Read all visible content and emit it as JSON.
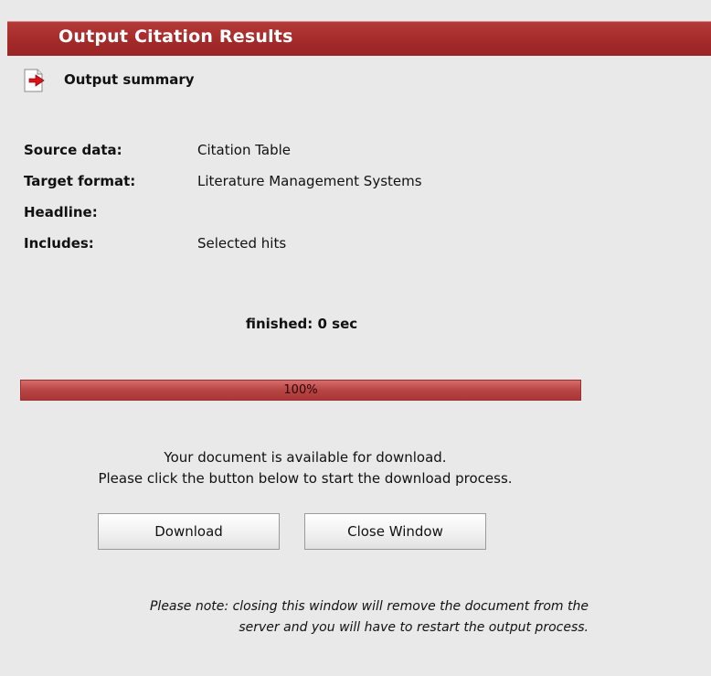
{
  "header": {
    "title": "Output Citation Results"
  },
  "summary": {
    "icon": "output-arrow-icon",
    "label": "Output summary"
  },
  "info": [
    {
      "key": "Source data:",
      "value": "Citation Table"
    },
    {
      "key": "Target format:",
      "value": "Literature Management Systems"
    },
    {
      "key": "Headline:",
      "value": ""
    },
    {
      "key": "Includes:",
      "value": "Selected hits"
    }
  ],
  "status": {
    "text": "finished: 0 sec"
  },
  "progress": {
    "percent": 100,
    "label": "100%"
  },
  "message": {
    "line1": "Your document is available for download.",
    "line2": "Please click the button below to start the download process."
  },
  "buttons": {
    "download": "Download",
    "close": "Close Window"
  },
  "note": {
    "line1": "Please note: closing this window will remove the document from the",
    "line2": "server and you will have to restart the output process."
  },
  "colors": {
    "header_bg": "#a52a2a",
    "progress_fill": "#b84545",
    "page_bg": "#e9e9e9"
  }
}
